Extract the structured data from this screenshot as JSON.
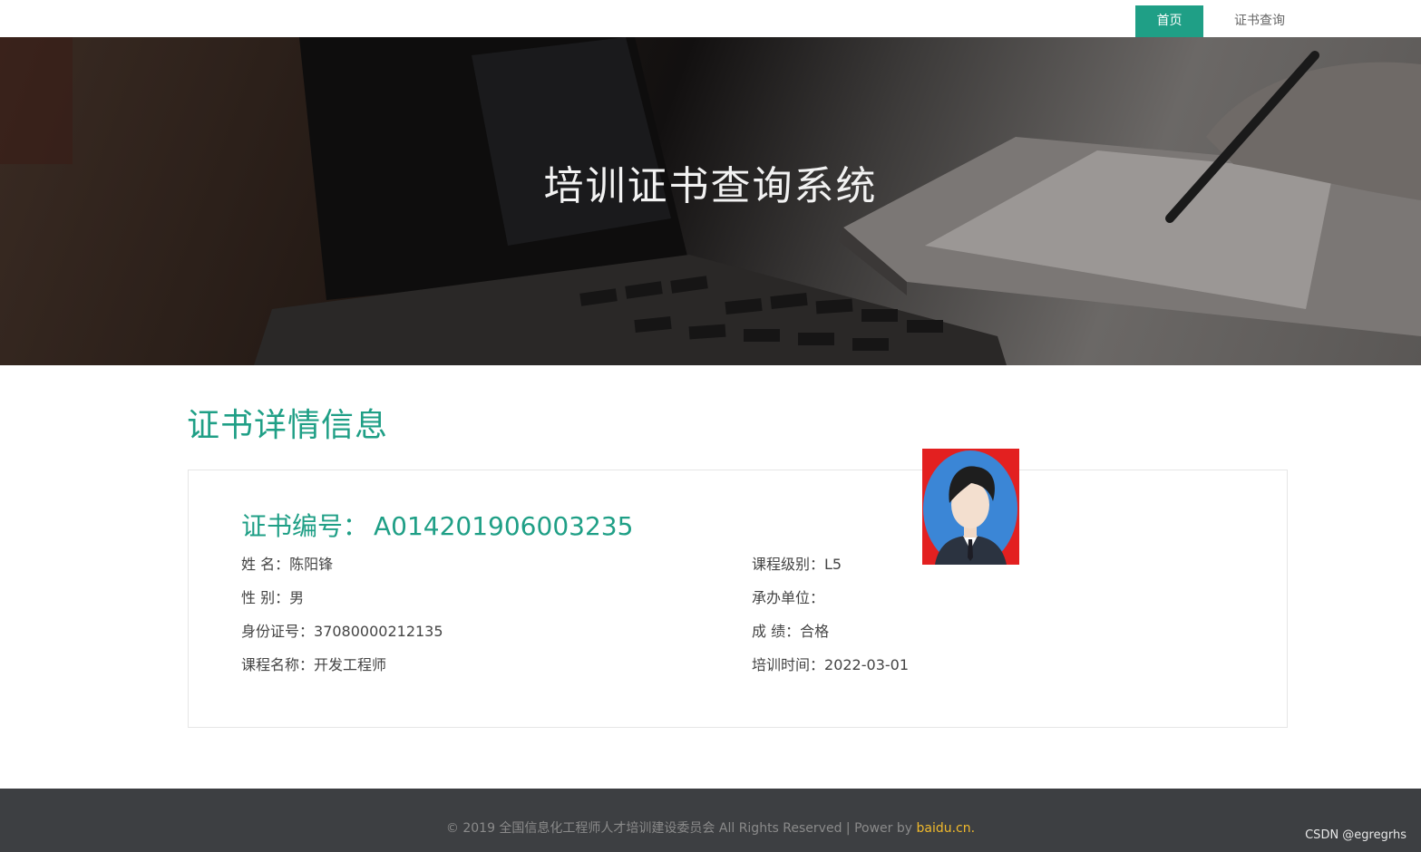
{
  "nav": {
    "home_label": "首页",
    "cert_query_label": "证书查询"
  },
  "hero": {
    "title": "培训证书查询系统"
  },
  "section": {
    "title": "证书详情信息"
  },
  "certificate": {
    "number_label": "证书编号：",
    "number_value": "A014201906003235",
    "left_fields": [
      {
        "label": "姓 名：",
        "value": "陈阳锋"
      },
      {
        "label": "性 别：",
        "value": "男"
      },
      {
        "label": "身份证号：",
        "value": "37080000212135"
      },
      {
        "label": "课程名称：",
        "value": "开发工程师"
      }
    ],
    "right_fields": [
      {
        "label": "课程级别：",
        "value": "L5"
      },
      {
        "label": "承办单位：",
        "value": ""
      },
      {
        "label": "成 绩：",
        "value": "合格"
      },
      {
        "label": "培训时间：",
        "value": "2022-03-01"
      }
    ]
  },
  "footer": {
    "text": "© 2019 全国信息化工程师人才培训建设委员会 All Rights Reserved | Power by ",
    "link": "baidu.cn."
  },
  "watermark": "CSDN @egregrhs",
  "colors": {
    "accent": "#1f9f86",
    "footer_bg": "#3d3f42",
    "footer_link": "#f0b92c",
    "avatar_bg": "#e32020"
  }
}
